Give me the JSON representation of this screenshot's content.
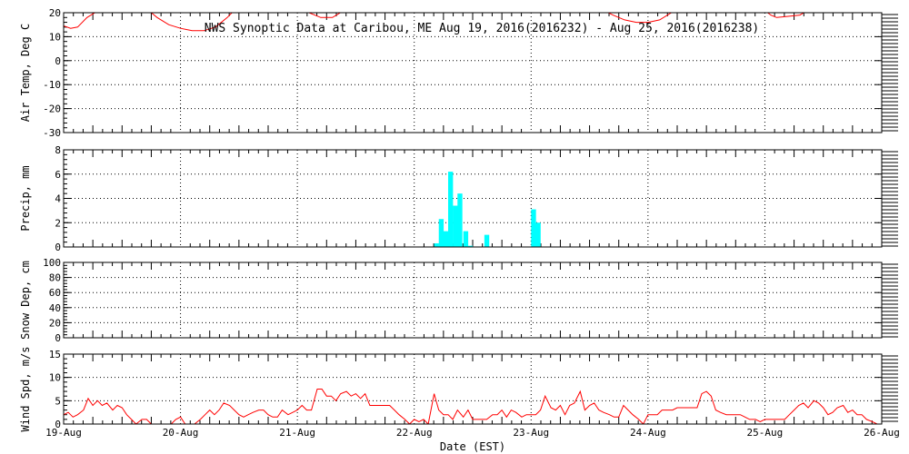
{
  "title": "NWS Synoptic Data at Caribou, ME   Aug 19, 2016(2016232) - Aug 25, 2016(2016238)",
  "colors": {
    "axis": "#000000",
    "grid": "#000000",
    "temp_line": "#ff0000",
    "precip_bar": "#00ffff",
    "wind_line": "#ff0000",
    "background": "#ffffff"
  },
  "chart_data": [
    {
      "type": "line",
      "name": "air-temp",
      "ylabel": "Air Temp, Deg C",
      "ylim": [
        -30,
        20
      ],
      "yticks": [
        -30,
        -20,
        -10,
        0,
        10,
        20
      ],
      "xlim": [
        0,
        7
      ],
      "grid": true,
      "x": [
        0.0,
        0.06,
        0.12,
        0.2,
        0.3,
        0.4,
        0.5,
        0.6,
        0.7,
        0.8,
        0.9,
        1.0,
        1.05,
        1.1,
        1.2,
        1.3,
        1.4,
        1.5,
        1.6,
        1.7,
        1.8,
        1.9,
        2.0,
        2.1,
        2.2,
        2.3,
        2.4,
        2.5,
        2.6,
        2.7,
        2.8,
        2.9,
        3.0,
        3.1,
        3.2,
        3.3,
        3.4,
        3.5,
        3.6,
        3.7,
        3.8,
        3.9,
        4.0,
        4.1,
        4.2,
        4.3,
        4.4,
        4.5,
        4.6,
        4.7,
        4.8,
        4.9,
        5.0,
        5.1,
        5.2,
        5.3,
        5.4,
        5.5,
        5.6,
        5.7,
        5.8,
        5.9,
        6.0,
        6.05,
        6.1,
        6.2,
        6.3,
        6.4,
        6.5,
        6.6,
        6.7,
        6.8,
        6.9,
        7.0
      ],
      "y": [
        14.5,
        13.5,
        14,
        18,
        21,
        23,
        24,
        24,
        22,
        18,
        15,
        13.5,
        13,
        12.5,
        12.5,
        14,
        18,
        23,
        25,
        25,
        24,
        23,
        22,
        20,
        18,
        18,
        21,
        24,
        24,
        22,
        22,
        23,
        24,
        25,
        26,
        27,
        27,
        27,
        26,
        25,
        24,
        23,
        21,
        20,
        20,
        22,
        24,
        23,
        21.5,
        19,
        17,
        16,
        16,
        17,
        20,
        23,
        24,
        24,
        22,
        21,
        20,
        20,
        21,
        19,
        18,
        18.5,
        19,
        22,
        24,
        25,
        23,
        22,
        22,
        21
      ]
    },
    {
      "type": "bar",
      "name": "precip",
      "ylabel": "Precip, mm",
      "ylim": [
        0,
        8
      ],
      "yticks": [
        0,
        2,
        4,
        6,
        8
      ],
      "xlim": [
        0,
        7
      ],
      "grid": true,
      "bar_width_days": 0.0417,
      "x": [
        3.17,
        3.21,
        3.25,
        3.29,
        3.33,
        3.37,
        3.42,
        3.46,
        3.6,
        4.0,
        4.04
      ],
      "values": [
        0.3,
        2.3,
        1.3,
        6.2,
        3.4,
        4.4,
        1.3,
        0.1,
        1.0,
        3.1,
        2.0
      ]
    },
    {
      "type": "line",
      "name": "snow-depth",
      "ylabel": "Snow Dep, cm",
      "ylim": [
        0,
        100
      ],
      "yticks": [
        0,
        20,
        40,
        60,
        80,
        100
      ],
      "xlim": [
        0,
        7
      ],
      "grid": true,
      "x": [],
      "y": []
    },
    {
      "type": "line",
      "name": "wind-speed",
      "ylabel": "Wind Spd, m/s",
      "xlabel": "Date (EST)",
      "ylim": [
        0,
        15
      ],
      "yticks": [
        0,
        5,
        10,
        15
      ],
      "xlim": [
        0,
        7
      ],
      "xticks": [
        0,
        1,
        2,
        3,
        4,
        5,
        6,
        7
      ],
      "xtick_labels": [
        "19-Aug",
        "20-Aug",
        "21-Aug",
        "22-Aug",
        "23-Aug",
        "24-Aug",
        "25-Aug",
        "26-Aug"
      ],
      "grid": true,
      "x": [
        0.0,
        0.04,
        0.08,
        0.12,
        0.17,
        0.21,
        0.25,
        0.29,
        0.33,
        0.37,
        0.42,
        0.46,
        0.5,
        0.54,
        0.58,
        0.62,
        0.67,
        0.71,
        0.75,
        0.79,
        0.83,
        0.87,
        0.92,
        0.96,
        1.0,
        1.04,
        1.08,
        1.12,
        1.17,
        1.21,
        1.25,
        1.29,
        1.33,
        1.37,
        1.42,
        1.46,
        1.5,
        1.54,
        1.58,
        1.62,
        1.67,
        1.71,
        1.75,
        1.79,
        1.83,
        1.87,
        1.92,
        1.96,
        2.0,
        2.04,
        2.08,
        2.12,
        2.17,
        2.21,
        2.25,
        2.29,
        2.33,
        2.37,
        2.42,
        2.46,
        2.5,
        2.54,
        2.58,
        2.62,
        2.67,
        2.71,
        2.75,
        2.79,
        2.83,
        2.87,
        2.92,
        2.96,
        3.0,
        3.04,
        3.08,
        3.12,
        3.17,
        3.21,
        3.25,
        3.29,
        3.33,
        3.37,
        3.42,
        3.46,
        3.5,
        3.54,
        3.58,
        3.62,
        3.67,
        3.71,
        3.75,
        3.79,
        3.83,
        3.87,
        3.92,
        3.96,
        4.0,
        4.04,
        4.08,
        4.12,
        4.17,
        4.21,
        4.25,
        4.29,
        4.33,
        4.37,
        4.42,
        4.46,
        4.5,
        4.54,
        4.58,
        4.62,
        4.67,
        4.71,
        4.75,
        4.79,
        4.83,
        4.87,
        4.92,
        4.96,
        5.0,
        5.04,
        5.08,
        5.12,
        5.17,
        5.21,
        5.25,
        5.29,
        5.33,
        5.37,
        5.42,
        5.46,
        5.5,
        5.54,
        5.58,
        5.62,
        5.67,
        5.71,
        5.75,
        5.79,
        5.83,
        5.87,
        5.92,
        5.96,
        6.0,
        6.04,
        6.08,
        6.12,
        6.17,
        6.21,
        6.25,
        6.29,
        6.33,
        6.37,
        6.42,
        6.46,
        6.5,
        6.54,
        6.58,
        6.62,
        6.67,
        6.71,
        6.75,
        6.79,
        6.83,
        6.87,
        6.92,
        6.96,
        7.0
      ],
      "y": [
        2,
        2.5,
        1.5,
        2,
        3,
        5.5,
        4,
        5,
        4,
        4.5,
        3,
        4,
        3.5,
        2,
        1,
        0,
        1,
        1,
        0,
        0,
        0,
        0,
        0,
        1,
        1.5,
        0,
        0,
        0,
        1,
        2,
        3,
        2,
        3,
        4.5,
        4,
        3,
        2,
        1.5,
        2,
        2.5,
        3,
        3,
        2,
        1.5,
        1.5,
        3,
        2,
        2.5,
        3,
        4,
        3,
        3,
        7.5,
        7.5,
        6,
        6,
        5,
        6.5,
        7,
        6,
        6.5,
        5.5,
        6.5,
        4,
        4,
        4,
        4,
        4,
        3,
        2,
        1,
        0,
        1,
        0.5,
        1,
        0,
        6.5,
        3,
        2,
        2,
        1,
        3,
        1.5,
        3,
        1,
        1,
        1,
        1,
        2,
        2,
        3,
        1.5,
        3,
        2.5,
        1.5,
        2,
        2,
        2,
        3,
        6,
        3.5,
        3,
        4,
        2,
        4,
        4.5,
        7,
        3,
        4,
        4.5,
        3,
        2.5,
        2,
        1.5,
        1.5,
        4,
        3,
        2,
        1,
        0,
        2,
        2,
        2,
        3,
        3,
        3,
        3.5,
        3.5,
        3.5,
        3.5,
        3.5,
        6.5,
        7,
        6,
        3,
        2.5,
        2,
        2,
        2,
        2,
        1.5,
        1,
        1,
        0.5,
        1,
        1,
        1,
        1,
        1,
        2,
        3,
        4,
        4.5,
        3.5,
        5,
        4.5,
        3.5,
        2,
        2.5,
        3.5,
        4,
        2.5,
        3,
        2,
        2,
        1,
        0.5,
        0
      ]
    }
  ]
}
